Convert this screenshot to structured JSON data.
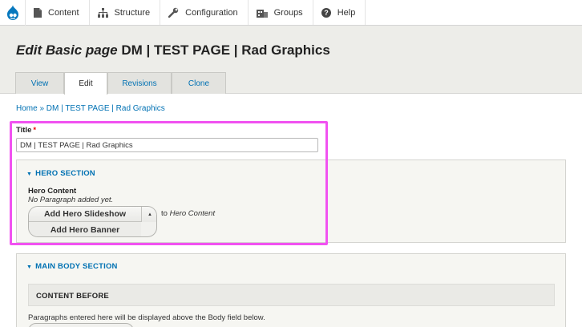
{
  "toolbar": {
    "items": [
      {
        "label": "Content",
        "icon": "file-icon"
      },
      {
        "label": "Structure",
        "icon": "sitemap-icon"
      },
      {
        "label": "Configuration",
        "icon": "wrench-icon"
      },
      {
        "label": "Groups",
        "icon": "group-icon"
      },
      {
        "label": "Help",
        "icon": "help-icon"
      }
    ]
  },
  "header": {
    "title_em": "Edit Basic page",
    "title_rest": " DM | TEST PAGE | Rad Graphics",
    "tabs": [
      {
        "label": "View"
      },
      {
        "label": "Edit"
      },
      {
        "label": "Revisions"
      },
      {
        "label": "Clone"
      }
    ]
  },
  "breadcrumb": {
    "text": "Home » DM | TEST PAGE | Rad Graphics"
  },
  "title_field": {
    "label": "Title",
    "required_mark": "*",
    "value": "DM | TEST PAGE | Rad Graphics"
  },
  "hero_section": {
    "title": "HERO SECTION",
    "toggle_glyph": "▼",
    "content_label": "Hero Content",
    "empty_text": "No Paragraph added yet.",
    "add_slideshow": "Add Hero Slideshow",
    "add_banner": "Add Hero Banner",
    "dropdown_glyph": "▲",
    "to_text": "to",
    "to_target": "Hero Content"
  },
  "main_body": {
    "title": "MAIN BODY SECTION",
    "toggle_glyph": "▼",
    "content_before_title": "CONTENT BEFORE",
    "help_text": "Paragraphs entered here will be displayed above the Body field below."
  },
  "colors": {
    "link": "#0071b3",
    "highlight": "#f152f1",
    "header_bg": "#edede9",
    "drupal_blue": "#0678be"
  }
}
